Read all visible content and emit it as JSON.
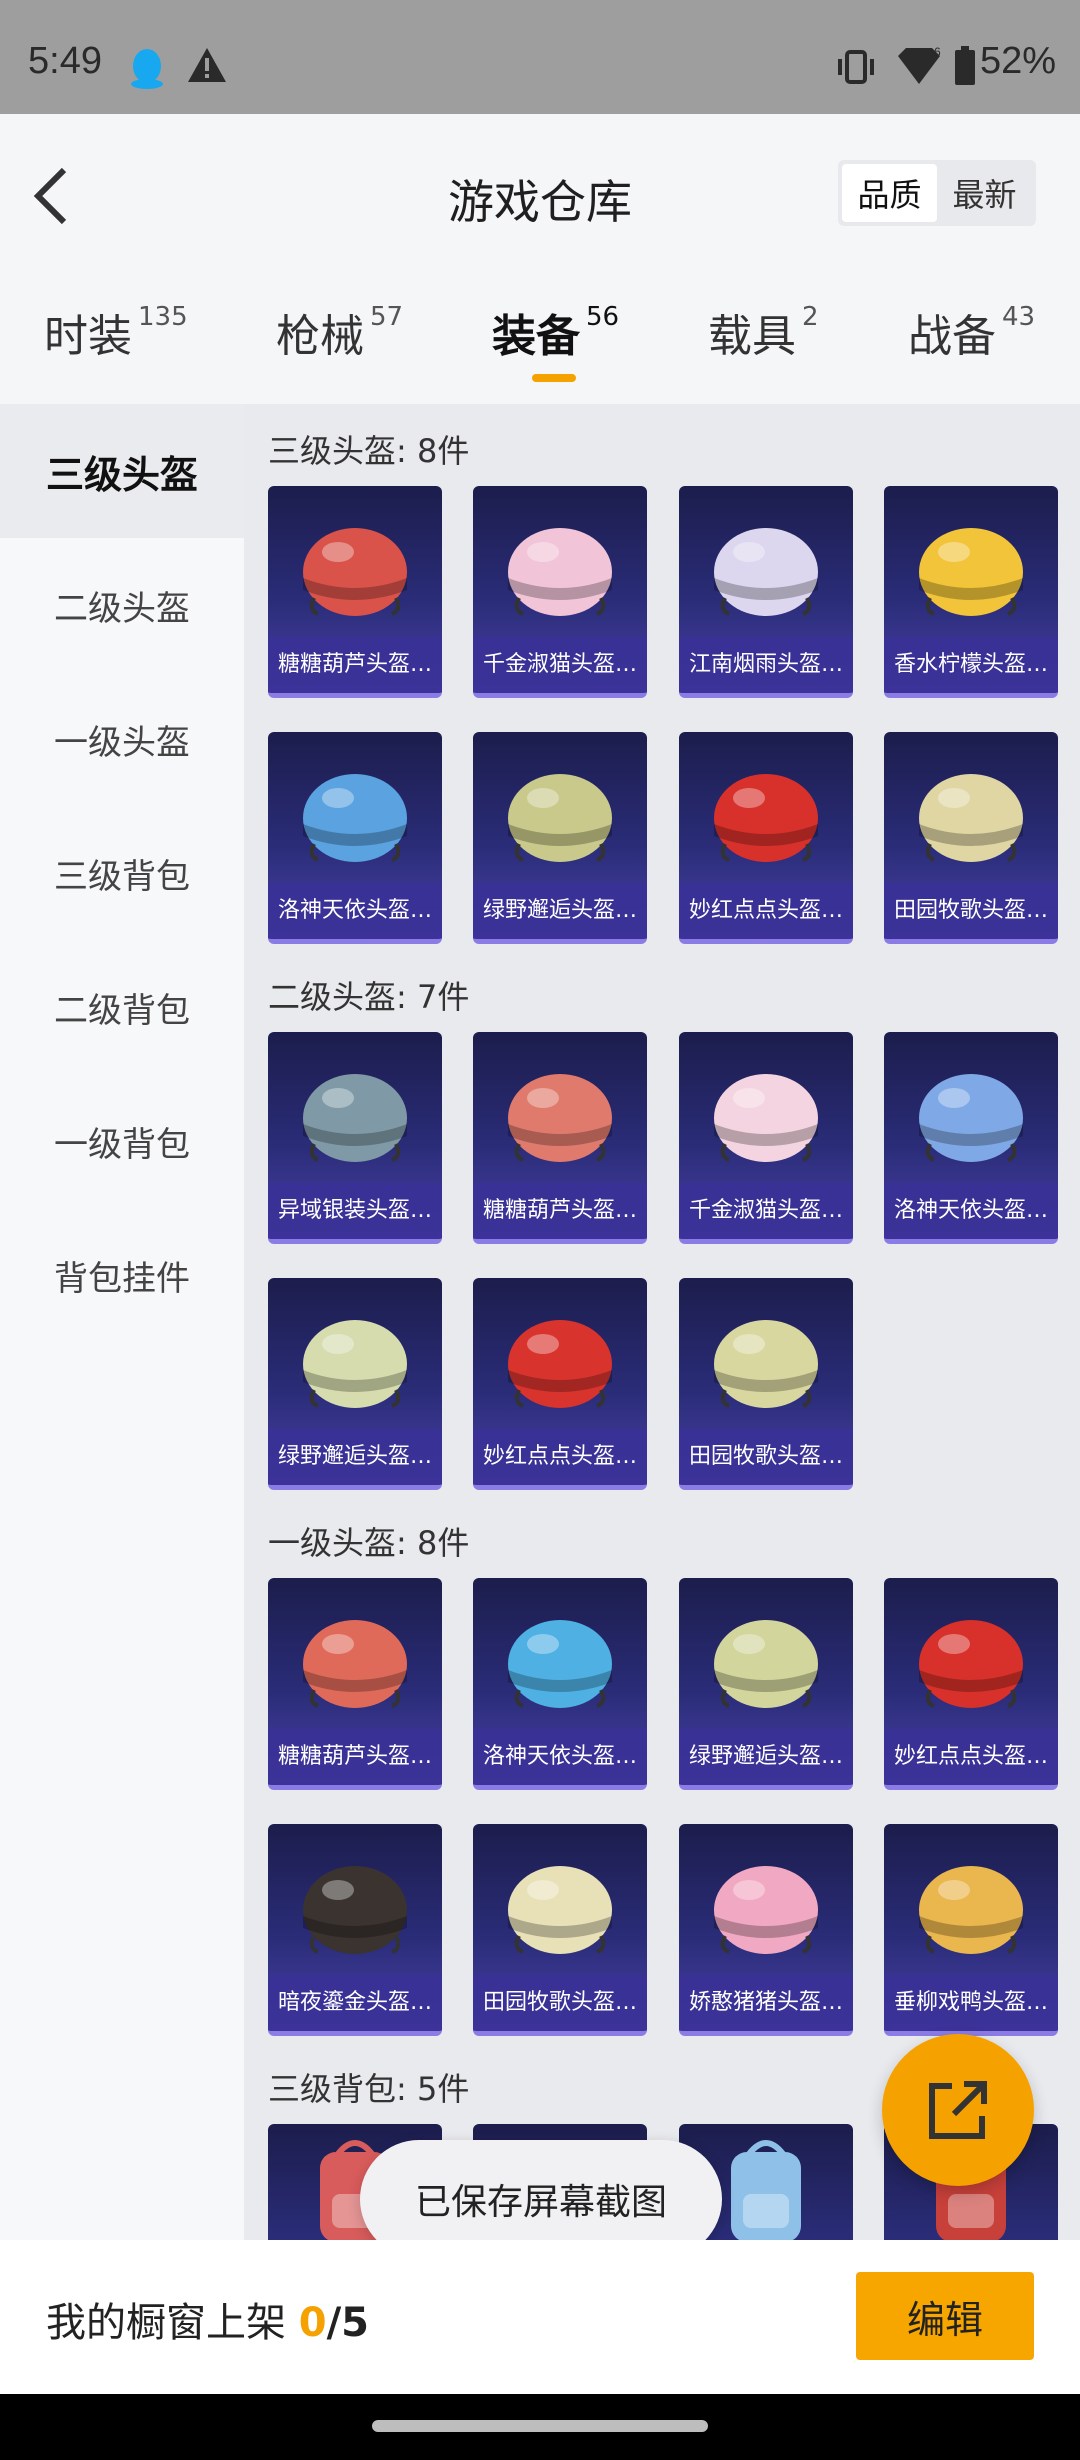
{
  "status_bar": {
    "time": "5:49",
    "battery": "52%"
  },
  "header": {
    "title": "游戏仓库",
    "sort_options": [
      {
        "label": "品质",
        "active": true
      },
      {
        "label": "最新",
        "active": false
      }
    ]
  },
  "tabs": [
    {
      "label": "时装",
      "count": "135"
    },
    {
      "label": "枪械",
      "count": "57"
    },
    {
      "label": "装备",
      "count": "56",
      "active": true
    },
    {
      "label": "载具",
      "count": "2"
    },
    {
      "label": "战备",
      "count": "43"
    }
  ],
  "sidebar": {
    "items": [
      {
        "label": "三级头盔",
        "active": true
      },
      {
        "label": "二级头盔"
      },
      {
        "label": "一级头盔"
      },
      {
        "label": "三级背包"
      },
      {
        "label": "二级背包"
      },
      {
        "label": "一级背包"
      },
      {
        "label": "背包挂件"
      }
    ]
  },
  "sections": [
    {
      "title": "三级头盔: 8件",
      "items": [
        {
          "label": "糖糖葫芦头盔…",
          "color": "#d9534a",
          "icon": "helmet-icon"
        },
        {
          "label": "千金淑猫头盔…",
          "color": "#f2c4d8",
          "icon": "helmet-icon"
        },
        {
          "label": "江南烟雨头盔…",
          "color": "#dcd6ee",
          "icon": "helmet-icon"
        },
        {
          "label": "香水柠檬头盔…",
          "color": "#f2c43a",
          "icon": "helmet-icon"
        },
        {
          "label": "洛神天依头盔…",
          "color": "#5aa2e0",
          "icon": "helmet-icon"
        },
        {
          "label": "绿野邂逅头盔…",
          "color": "#c8c98a",
          "icon": "helmet-icon"
        },
        {
          "label": "妙红点点头盔…",
          "color": "#d8312c",
          "icon": "helmet-icon"
        },
        {
          "label": "田园牧歌头盔…",
          "color": "#dfd6a4",
          "icon": "helmet-icon"
        }
      ]
    },
    {
      "title": "二级头盔: 7件",
      "items": [
        {
          "label": "异域银装头盔…",
          "color": "#7f9aa6",
          "icon": "helmet-icon"
        },
        {
          "label": "糖糖葫芦头盔…",
          "color": "#e07a6c",
          "icon": "helmet-icon"
        },
        {
          "label": "千金淑猫头盔…",
          "color": "#f4d4e0",
          "icon": "helmet-icon"
        },
        {
          "label": "洛神天依头盔…",
          "color": "#7fa8e6",
          "icon": "helmet-icon"
        },
        {
          "label": "绿野邂逅头盔…",
          "color": "#d6dcae",
          "icon": "helmet-icon"
        },
        {
          "label": "妙红点点头盔…",
          "color": "#d9332e",
          "icon": "helmet-icon"
        },
        {
          "label": "田园牧歌头盔…",
          "color": "#d9d7a0",
          "icon": "helmet-icon"
        }
      ]
    },
    {
      "title": "一级头盔: 8件",
      "items": [
        {
          "label": "糖糖葫芦头盔…",
          "color": "#e06a5a",
          "icon": "helmet-icon"
        },
        {
          "label": "洛神天依头盔…",
          "color": "#4fb0e4",
          "icon": "helmet-icon"
        },
        {
          "label": "绿野邂逅头盔…",
          "color": "#d2d59c",
          "icon": "helmet-icon"
        },
        {
          "label": "妙红点点头盔…",
          "color": "#d8302a",
          "icon": "helmet-icon"
        },
        {
          "label": "暗夜鎏金头盔…",
          "color": "#3a3330",
          "icon": "helmet-icon"
        },
        {
          "label": "田园牧歌头盔…",
          "color": "#e8e1b8",
          "icon": "helmet-icon"
        },
        {
          "label": "娇憨猪猪头盔…",
          "color": "#f1a8c2",
          "icon": "helmet-icon"
        },
        {
          "label": "垂柳戏鸭头盔…",
          "color": "#eab64e",
          "icon": "helmet-icon"
        }
      ]
    },
    {
      "title": "三级背包: 5件",
      "items": [
        {
          "label": "",
          "color": "#d95c5c",
          "icon": "backpack-icon"
        },
        {
          "label": "",
          "color": "#a79cd8",
          "icon": "backpack-icon"
        },
        {
          "label": "",
          "color": "#8ec0e8",
          "icon": "backpack-icon"
        },
        {
          "label": "",
          "color": "#c8403a",
          "icon": "backpack-icon"
        }
      ]
    }
  ],
  "toast": "已保存屏幕截图",
  "bottom_bar": {
    "label": "我的橱窗上架",
    "count": "0",
    "total": "/5",
    "edit_label": "编辑"
  },
  "colors": {
    "accent": "#f5a200",
    "card_bg": "#2a2c78",
    "status_bar": "#9e9e9e"
  }
}
